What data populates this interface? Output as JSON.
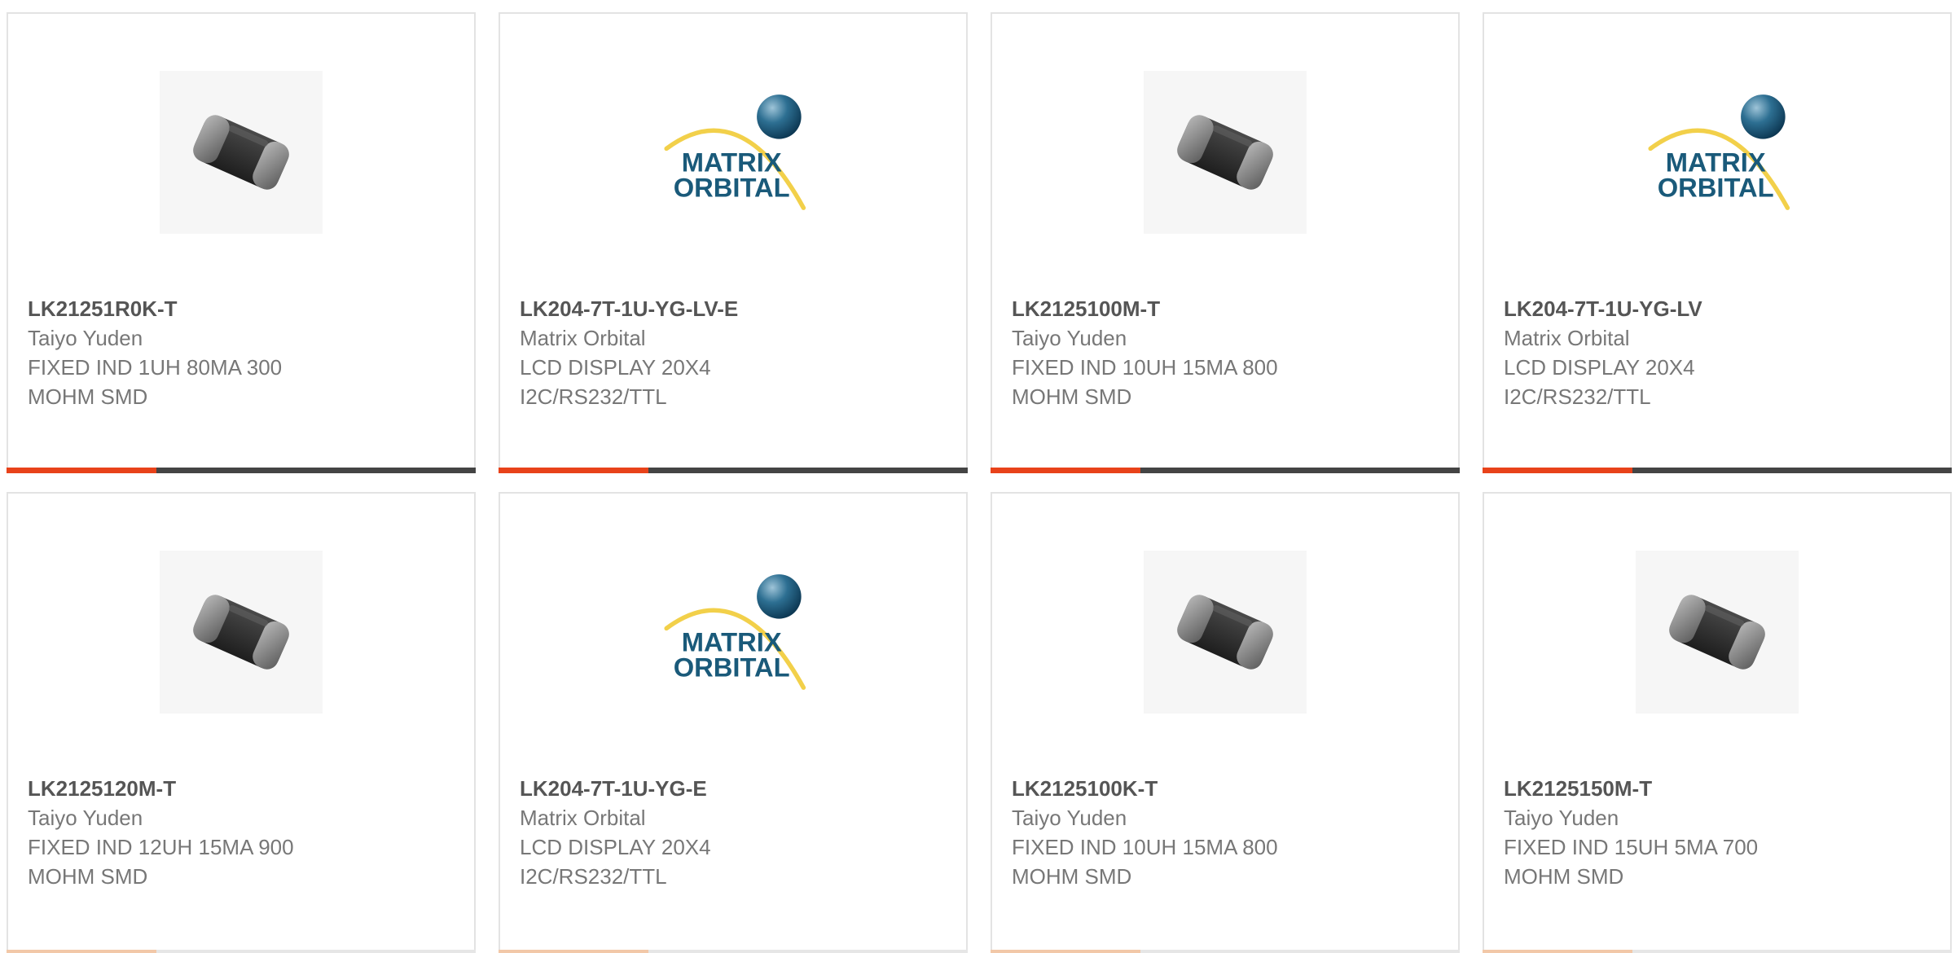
{
  "logo_text": {
    "line1": "MATRIX",
    "line2": "ORBITAL"
  },
  "colors": {
    "accent_bar": "#e8421a",
    "dark_bar": "#444444",
    "card_border": "#e3e3e3",
    "part_number_text": "#555555",
    "secondary_text": "#777777",
    "logo_blue": "#1a5a7a",
    "logo_arc": "#f2d04a"
  },
  "products": [
    {
      "part_number": "LK21251R0K-T",
      "manufacturer": "Taiyo Yuden",
      "description": "FIXED IND 1UH 80MA 300 MOHM SMD",
      "image_icon": "smd-inductor-icon"
    },
    {
      "part_number": "LK204-7T-1U-YG-LV-E",
      "manufacturer": "Matrix Orbital",
      "description": "LCD DISPLAY 20X4 I2C/RS232/TTL",
      "image_icon": "matrix-orbital-logo"
    },
    {
      "part_number": "LK2125100M-T",
      "manufacturer": "Taiyo Yuden",
      "description": "FIXED IND 10UH 15MA 800 MOHM SMD",
      "image_icon": "smd-inductor-icon"
    },
    {
      "part_number": "LK204-7T-1U-YG-LV",
      "manufacturer": "Matrix Orbital",
      "description": "LCD DISPLAY 20X4 I2C/RS232/TTL",
      "image_icon": "matrix-orbital-logo"
    },
    {
      "part_number": "LK2125120M-T",
      "manufacturer": "Taiyo Yuden",
      "description": "FIXED IND 12UH 15MA 900 MOHM SMD",
      "image_icon": "smd-inductor-icon"
    },
    {
      "part_number": "LK204-7T-1U-YG-E",
      "manufacturer": "Matrix Orbital",
      "description": "LCD DISPLAY 20X4 I2C/RS232/TTL",
      "image_icon": "matrix-orbital-logo"
    },
    {
      "part_number": "LK2125100K-T",
      "manufacturer": "Taiyo Yuden",
      "description": "FIXED IND 10UH 15MA 800 MOHM SMD",
      "image_icon": "smd-inductor-icon"
    },
    {
      "part_number": "LK2125150M-T",
      "manufacturer": "Taiyo Yuden",
      "description": "FIXED IND 15UH 5MA 700 MOHM SMD",
      "image_icon": "smd-inductor-icon"
    }
  ]
}
